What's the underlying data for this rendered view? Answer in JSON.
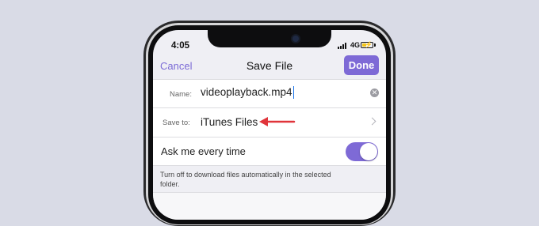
{
  "status_bar": {
    "time": "4:05",
    "network": "4G"
  },
  "nav": {
    "cancel_label": "Cancel",
    "title": "Save File",
    "done_label": "Done"
  },
  "form": {
    "name_label": "Name:",
    "name_value": "videoplayback.mp4",
    "save_to_label": "Save to:",
    "save_to_value": "iTunes Files",
    "ask_label": "Ask me every time",
    "ask_enabled": true,
    "footnote": "Turn off to download files automatically in the selected folder."
  },
  "colors": {
    "accent": "#7e6ad6",
    "annotation_arrow": "#e0343a",
    "background": "#d9dbe6"
  },
  "icons": [
    "signal-icon",
    "battery-icon",
    "clear-icon",
    "chevron-right-icon",
    "annotation-arrow-icon"
  ]
}
